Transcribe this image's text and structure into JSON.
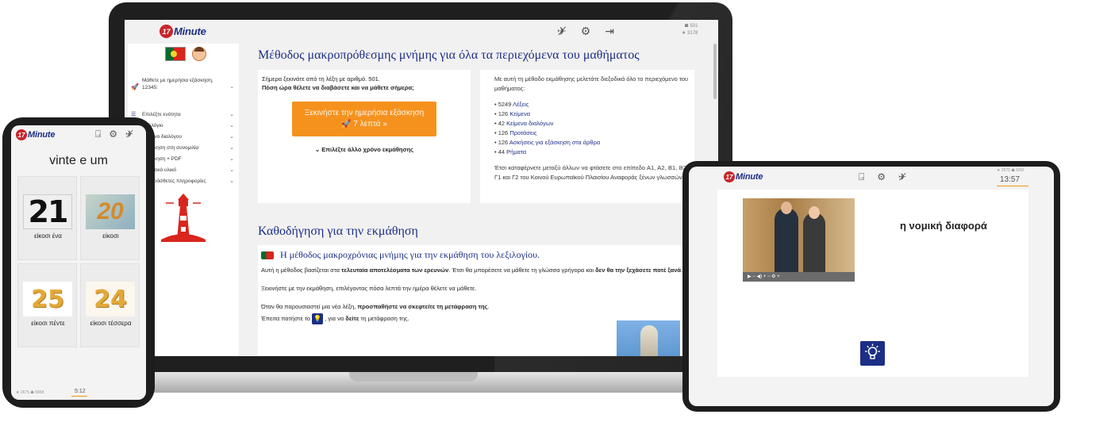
{
  "laptop": {
    "logo": {
      "badge": "17",
      "word": "Minute"
    },
    "header_icons": [
      "no-flight-icon",
      "gear-icon",
      "logout-icon"
    ],
    "stats": {
      "line1": "501",
      "line2": "3178"
    },
    "sidebar": {
      "lesson": "Μάθετε με ημερήσια εξάσκηση, 12345:",
      "items": [
        {
          "label": "Επιλέξτε ενότητα"
        },
        {
          "label": "Λεξιλόγιο"
        },
        {
          "label": "Κείμενο διαλόγου"
        },
        {
          "label": "Εξάσκηση στη συνομιλία"
        },
        {
          "label": "Εξάσκηση + PDF"
        },
        {
          "label": "Πρακτικό υλικό"
        },
        {
          "label": "Επιπρόσθετες πληροφορίες"
        }
      ]
    },
    "main": {
      "title": "Μέθοδος μακροπρόθεσμης μνήμης για όλα τα περιεχόμενα του μαθήματος",
      "left_card": {
        "line1": "Σήμερα ξεκινάτε από τη λέξη με αριθμό. 501.",
        "line2": "Πόση ώρα θέλετε να διαβάσετε και να μάθετε σήμερα;",
        "button_line1": "Ξεκινήστε την ημερήσια εξάσκηση",
        "button_line2": "🚀 7 λεπτά »",
        "other_time": "⌄ Επιλέξτε άλλο χρόνο εκμάθησης"
      },
      "right_card": {
        "intro": "Με αυτή τη μέθοδο εκμάθησης μελετάτε διεξοδικά όλο το περιεχόμενο του μαθήματος:",
        "items": [
          {
            "count": "• 5249",
            "label": "Λέξεις"
          },
          {
            "count": "• 126",
            "label": "Κείμενα"
          },
          {
            "count": "• 42",
            "label": "Κείμενα διαλόγων"
          },
          {
            "count": "• 126",
            "label": "Προτάσεις"
          },
          {
            "count": "• 126",
            "label": "Ασκήσεις για εξάσκηση στα άρθρα"
          },
          {
            "count": "• 44",
            "label": "Ρήματα"
          }
        ],
        "outro": "Έτσι καταφέρνετε μεταξύ άλλων να φτάσετε στο επίπεδο Α1, Α2, Β1, Β2, Γ1 και Γ2 του Κοινού Ευρωπαϊκού Πλαισίου Αναφοράς ξένων γλωσσών."
      },
      "guide_title": "Καθοδήγηση για την εκμάθηση",
      "guide": {
        "heading": "Η μέθοδος μακροχρόνιας μνήμης για την εκμάθηση του λεξιλογίου.",
        "p1_a": "Αυτή η μέθοδος βασίζεται στα ",
        "p1_b": "τελευταία αποτελέσματα των ερευνών",
        "p1_c": ". Έτσι θα μπορέσετε να μάθετε τη γλώσσα γρήγορα και ",
        "p1_d": "δεν θα την ξεχάσετε ποτέ ξανά",
        "p1_e": ".",
        "p2": "Ξεκινήστε με την εκμάθηση, επιλέγοντας πόσα λεπτά την ημέρα θέλετε να μάθετε.",
        "p3_a": "Όταν θα παρουσιαστεί μια νέα λέξη, ",
        "p3_b": "προσπαθήστε να σκεφτείτε τη μετάφραση της",
        "p3_c": ".",
        "p4_a": "Έπειτα πατήστε το ",
        "p4_b": " , για να ",
        "p4_c": "δείτε",
        "p4_d": " τη μετάφραση της."
      }
    }
  },
  "phone": {
    "logo": {
      "badge": "17",
      "word": "Minute"
    },
    "word": "vinte e um",
    "tiles": [
      {
        "number": "21",
        "caption": "είκοσι ένα"
      },
      {
        "number": "20",
        "caption": "είκοσι"
      },
      {
        "number": "25",
        "caption": "είκοσι πέντε"
      },
      {
        "number": "24",
        "caption": "είκοσι τέσσερα"
      }
    ],
    "stats": "★ 2675 ☗ 5868",
    "time": "5:12"
  },
  "tablet": {
    "logo": {
      "badge": "17",
      "word": "Minute"
    },
    "stats": "★ 2675 ☗ 5/68",
    "time": "13:57",
    "word": "η νομική διαφορά",
    "video_controls": "▶    − ◀) +    − ⚙ +"
  },
  "colors": {
    "brand_blue": "#1c2f86",
    "accent_orange": "#f5921e",
    "logo_red": "#c7262b"
  }
}
